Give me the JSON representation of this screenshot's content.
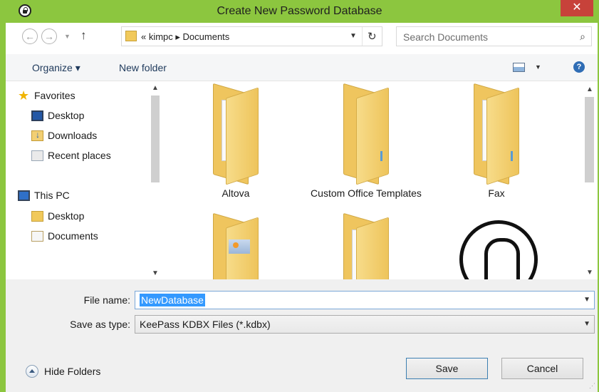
{
  "window": {
    "title": "Create New Password Database",
    "close_label": "✕",
    "accent_color": "#8cc63f"
  },
  "navigation": {
    "back_icon": "back-arrow-icon",
    "forward_icon": "forward-arrow-icon",
    "up_icon": "up-arrow-icon",
    "address": "« kimpc ▸ Documents",
    "search_placeholder": "Search Documents"
  },
  "toolbar": {
    "organize_label": "Organize ▾",
    "new_folder_label": "New folder"
  },
  "sidebar": {
    "favorites_label": "Favorites",
    "favorites": [
      "Desktop",
      "Downloads",
      "Recent places"
    ],
    "this_pc_label": "This PC",
    "this_pc": [
      "Desktop",
      "Documents"
    ]
  },
  "content": {
    "folders": [
      "Altova",
      "Custom Office Templates",
      "Fax"
    ]
  },
  "form": {
    "file_name_label": "File name:",
    "file_name_value": "NewDatabase",
    "save_type_label": "Save as type:",
    "save_type_value": "KeePass KDBX Files (*.kdbx)"
  },
  "footer": {
    "hide_folders_label": "Hide Folders",
    "save_label": "Save",
    "cancel_label": "Cancel"
  }
}
